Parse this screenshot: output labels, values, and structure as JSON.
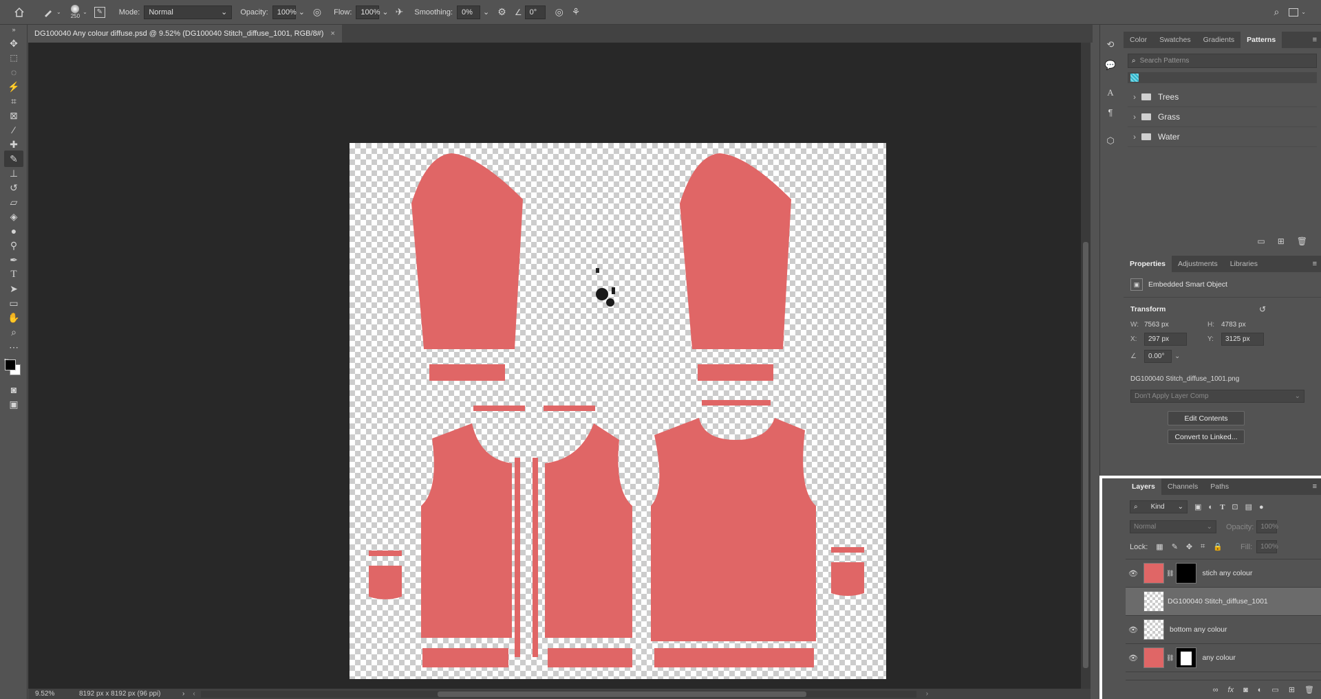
{
  "options_bar": {
    "brush_size": "250",
    "mode_label": "Mode:",
    "mode_value": "Normal",
    "opacity_label": "Opacity:",
    "opacity_value": "100%",
    "flow_label": "Flow:",
    "flow_value": "100%",
    "smoothing_label": "Smoothing:",
    "smoothing_value": "0%",
    "angle_value": "0°"
  },
  "document": {
    "tab_title": "DG100040 Any colour diffuse.psd @ 9.52% (DG100040 Stitch_diffuse_1001, RGB/8#)",
    "close_glyph": "×",
    "garment_color": "#e06666"
  },
  "status": {
    "zoom": "9.52%",
    "dimensions": "8192 px x 8192 px (96 ppi)"
  },
  "patterns_panel": {
    "tabs": [
      "Color",
      "Swatches",
      "Gradients",
      "Patterns"
    ],
    "active_tab": "Patterns",
    "search_placeholder": "Search Patterns",
    "folders": [
      "Trees",
      "Grass",
      "Water"
    ]
  },
  "properties_panel": {
    "tabs": [
      "Properties",
      "Adjustments",
      "Libraries"
    ],
    "active_tab": "Properties",
    "object_type": "Embedded Smart Object",
    "section_title": "Transform",
    "w_label": "W:",
    "w_value": "7563 px",
    "h_label": "H:",
    "h_value": "4783 px",
    "x_label": "X:",
    "x_value": "297 px",
    "y_label": "Y:",
    "y_value": "3125 px",
    "angle_value": "0.00°",
    "filename": "DG100040 Stitch_diffuse_1001.png",
    "layer_comp": "Don't Apply Layer Comp",
    "edit_button": "Edit Contents",
    "convert_button": "Convert to Linked..."
  },
  "layers_panel": {
    "tabs": [
      "Layers",
      "Channels",
      "Paths"
    ],
    "active_tab": "Layers",
    "filter_kind": "Kind",
    "blend_mode": "Normal",
    "opacity_label": "Opacity:",
    "opacity_value": "100%",
    "lock_label": "Lock:",
    "fill_label": "Fill:",
    "fill_value": "100%",
    "layers": [
      {
        "name": "stich any colour"
      },
      {
        "name": "DG100040 Stitch_diffuse_1001"
      },
      {
        "name": "bottom any colour"
      },
      {
        "name": "any colour"
      }
    ]
  }
}
